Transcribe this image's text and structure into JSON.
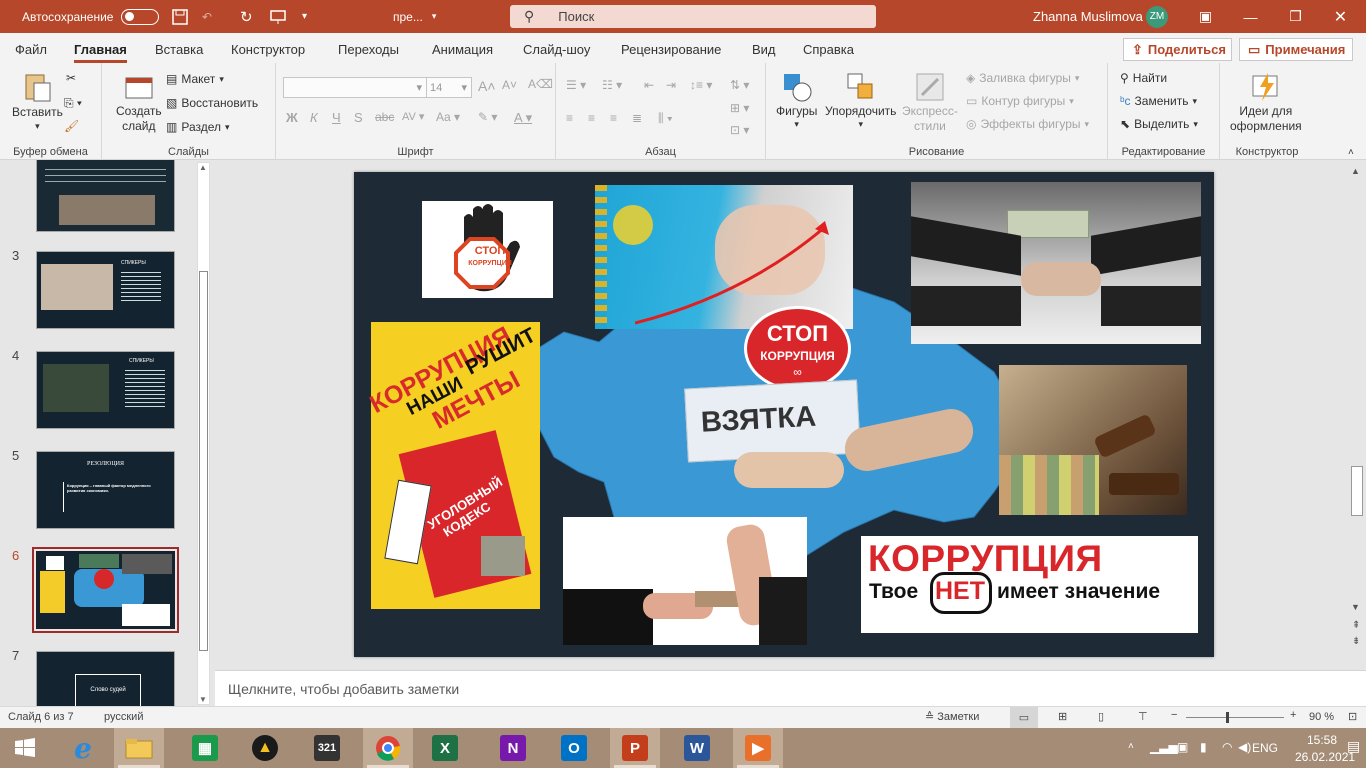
{
  "titlebar": {
    "autosave": "Автосохранение",
    "filename": "пре...",
    "search": "Поиск",
    "user": "Zhanna Muslimova",
    "initials": "ZM"
  },
  "tabs": [
    "Файл",
    "Главная",
    "Вставка",
    "Конструктор",
    "Переходы",
    "Анимация",
    "Слайд-шоу",
    "Рецензирование",
    "Вид",
    "Справка"
  ],
  "share": "Поделиться",
  "comments": "Примечания",
  "ribbon": {
    "clipboard": {
      "paste": "Вставить",
      "label": "Буфер обмена"
    },
    "slides": {
      "new_slide_1": "Создать",
      "new_slide_2": "слайд",
      "layout": "Макет",
      "reset": "Восстановить",
      "section": "Раздел",
      "label": "Слайды"
    },
    "font": {
      "size": "14",
      "label": "Шрифт"
    },
    "paragraph": {
      "label": "Абзац"
    },
    "drawing": {
      "shapes": "Фигуры",
      "arrange": "Упорядочить",
      "styles_1": "Экспресс-",
      "styles_2": "стили",
      "fill": "Заливка фигуры",
      "outline": "Контур фигуры",
      "effects": "Эффекты фигуры",
      "label": "Рисование"
    },
    "editing": {
      "find": "Найти",
      "replace": "Заменить",
      "select": "Выделить",
      "label": "Редактирование"
    },
    "designer": {
      "ideas_1": "Идеи для",
      "ideas_2": "оформления",
      "label": "Конструктор"
    }
  },
  "thumbs": [
    {
      "num": "3",
      "title": "СПИКЕРЫ"
    },
    {
      "num": "4",
      "title": "СПИКЕРЫ"
    },
    {
      "num": "5",
      "title": "РЕЗОЛЮЦИЯ",
      "text": "Коррупция – главный фактор медленного развития экономики."
    },
    {
      "num": "6"
    },
    {
      "num": "7",
      "text": "Слово судей"
    }
  ],
  "slide": {
    "stop": "СТОП",
    "corruption": "КОРРУПЦИЯ",
    "poster_1": "КОРРУПЦИЯ",
    "poster_2": "РУШИТ",
    "poster_3": "НАШИ",
    "poster_4": "МЕЧТЫ",
    "codex_1": "УГОЛОВНЫЙ",
    "codex_2": "КОДЕКС",
    "bribe": "ВЗЯТКА",
    "banner_title": "КОРРУПЦИЯ",
    "banner_a": "Твое",
    "banner_b": "НЕТ",
    "banner_c": "имеет значение"
  },
  "notes": "Щелкните, чтобы добавить заметки",
  "status": {
    "slide": "Слайд 6 из 7",
    "lang": "русский",
    "notes": "Заметки",
    "zoom": "90 %"
  },
  "taskbar": {
    "lang": "ENG",
    "time": "15:58",
    "date": "26.02.2021"
  },
  "colors": {
    "accent": "#b7472a",
    "taskbar": "#a48c76",
    "map": "#3a98d4"
  }
}
